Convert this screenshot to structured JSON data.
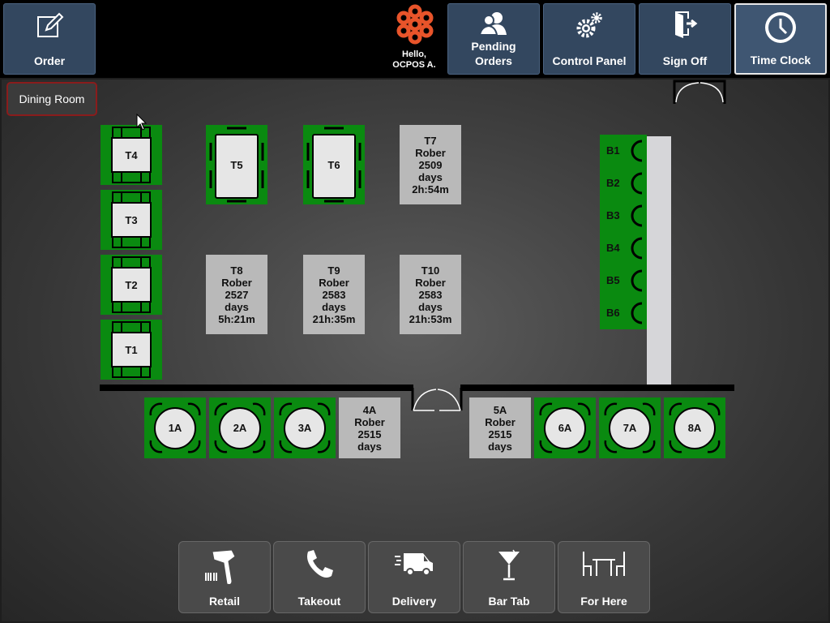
{
  "topbar": {
    "buttons": [
      {
        "label": "Order",
        "icon": "pencil-square-icon"
      },
      {
        "label": "Pending\nOrders",
        "icon": "users-icon"
      },
      {
        "label": "Control Panel",
        "icon": "gears-icon"
      },
      {
        "label": "Sign Off",
        "icon": "exit-door-icon"
      },
      {
        "label": "Time Clock",
        "icon": "clock-icon"
      }
    ],
    "greeting": "Hello,\nOCPOS A.",
    "logo_color": "#e8542a"
  },
  "room_tab": "Dining Room",
  "tables": {
    "t4": "T4",
    "t3": "T3",
    "t2": "T2",
    "t1": "T1",
    "t5": "T5",
    "t6": "T6",
    "t7": [
      "T7",
      "Rober",
      "2509",
      "days",
      "2h:54m"
    ],
    "t8": [
      "T8",
      "Rober",
      "2527",
      "days",
      "5h:21m"
    ],
    "t9": [
      "T9",
      "Rober",
      "2583",
      "days",
      "21h:35m"
    ],
    "t10": [
      "T10",
      "Rober",
      "2583",
      "days",
      "21h:53m"
    ],
    "bar": [
      "B1",
      "B2",
      "B3",
      "B4",
      "B5",
      "B6"
    ],
    "round": {
      "a1": "1A",
      "a2": "2A",
      "a3": "3A",
      "a6": "6A",
      "a7": "7A",
      "a8": "8A"
    },
    "a4": [
      "4A",
      "Rober",
      "2515",
      "days"
    ],
    "a5": [
      "5A",
      "Rober",
      "2515",
      "days"
    ]
  },
  "bottom": [
    {
      "label": "Retail",
      "icon": "barcode-scanner-icon"
    },
    {
      "label": "Takeout",
      "icon": "phone-icon"
    },
    {
      "label": "Delivery",
      "icon": "delivery-van-icon"
    },
    {
      "label": "Bar Tab",
      "icon": "cocktail-icon"
    },
    {
      "label": "For Here",
      "icon": "table-chairs-icon"
    }
  ],
  "colors": {
    "available": "#0a8a10",
    "occupied": "#b9b9b9",
    "button": "#33475f"
  }
}
